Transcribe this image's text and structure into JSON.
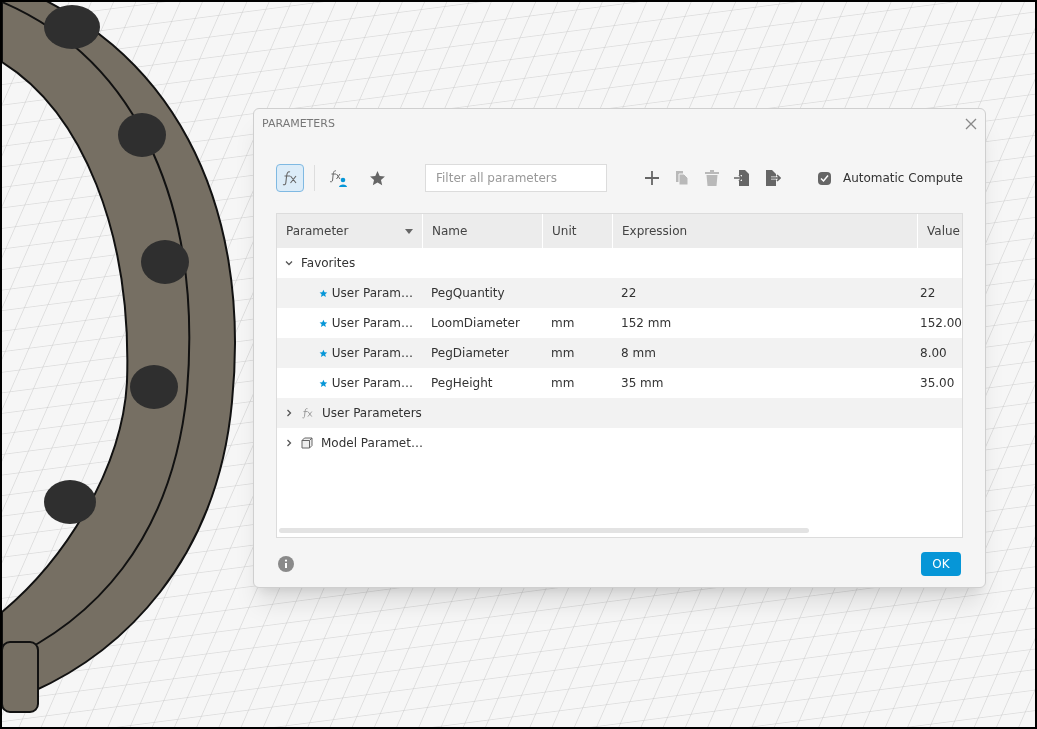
{
  "dialog": {
    "title": "PARAMETERS"
  },
  "toolbar": {
    "views": [
      {
        "kind": "all",
        "selected": true
      },
      {
        "kind": "user",
        "selected": false
      },
      {
        "kind": "favorites",
        "selected": false
      }
    ],
    "filter": {
      "placeholder": "Filter all parameters"
    },
    "actions": [
      {
        "kind": "add",
        "disabled": false
      },
      {
        "kind": "copy",
        "disabled": true
      },
      {
        "kind": "delete",
        "disabled": true
      },
      {
        "kind": "import",
        "disabled": false
      },
      {
        "kind": "export",
        "disabled": false
      }
    ],
    "auto_compute": {
      "label": "Automatic Compute",
      "checked": true
    }
  },
  "table": {
    "columns": [
      "Parameter",
      "Name",
      "Unit",
      "Expression",
      "Value"
    ],
    "groups": [
      {
        "kind": "favorites",
        "label": "Favorites",
        "expanded": true,
        "children": [
          {
            "parameter": "User Param…",
            "name": "PegQuantity",
            "expression": "22",
            "value": "22",
            "favorite": true
          },
          {
            "parameter": "User Param…",
            "name": "LoomDiameter",
            "unit": "mm",
            "expression": "152 mm",
            "value": "152.00",
            "favorite": true
          },
          {
            "parameter": "User Param…",
            "name": "PegDiameter",
            "unit": "mm",
            "expression": "8 mm",
            "value": "8.00",
            "favorite": true
          },
          {
            "parameter": "User Param…",
            "name": "PegHeight",
            "unit": "mm",
            "expression": "35 mm",
            "value": "35.00",
            "favorite": true
          }
        ]
      },
      {
        "kind": "user",
        "label": "User Parameters",
        "expanded": false
      },
      {
        "kind": "model",
        "label": "Model Paramet…",
        "expanded": false
      }
    ]
  },
  "ok_button": "OK"
}
